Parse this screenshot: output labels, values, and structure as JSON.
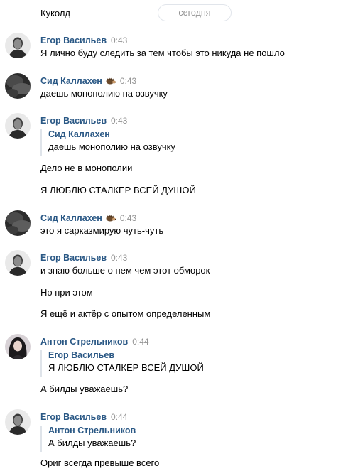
{
  "top": {
    "prev_text": "Куколд",
    "date_label": "сегодня"
  },
  "messages": [
    {
      "author": "Егор Васильев",
      "time": "0:43",
      "lines": [
        "Я лично буду следить за тем чтобы это никуда не пошло"
      ]
    },
    {
      "author": "Сид Каллахен",
      "status_icon": "hedgehog-icon",
      "time": "0:43",
      "lines": [
        "даешь монополию на озвучку"
      ]
    },
    {
      "author": "Егор Васильев",
      "time": "0:43",
      "quote": {
        "author": "Сид Каллахен",
        "text": "даешь монополию на озвучку"
      },
      "lines": [
        "Дело не в монополии",
        "Я ЛЮБЛЮ СТАЛКЕР ВСЕЙ ДУШОЙ"
      ]
    },
    {
      "author": "Сид Каллахен",
      "status_icon": "hedgehog-icon",
      "time": "0:43",
      "lines": [
        "это я сарказмирую чуть-чуть"
      ]
    },
    {
      "author": "Егор Васильев",
      "time": "0:43",
      "lines": [
        "и знаю больше о нем чем этот обморок",
        "Но при этом",
        "Я ещё и актёр с опытом определенным"
      ]
    },
    {
      "author": "Антон Стрельников",
      "time": "0:44",
      "quote": {
        "author": "Егор Васильев",
        "text": "Я ЛЮБЛЮ СТАЛКЕР ВСЕЙ ДУШОЙ"
      },
      "lines": [
        "А билды уважаешь?"
      ]
    },
    {
      "author": "Егор Васильев",
      "time": "0:44",
      "quote": {
        "author": "Антон Стрельников",
        "text": "А билды уважаешь?"
      },
      "lines": [
        "Ориг всегда превыше всего"
      ]
    }
  ],
  "colors": {
    "author": "#2a5885",
    "meta": "#939393",
    "quote_bar": "#dfe4ea"
  }
}
